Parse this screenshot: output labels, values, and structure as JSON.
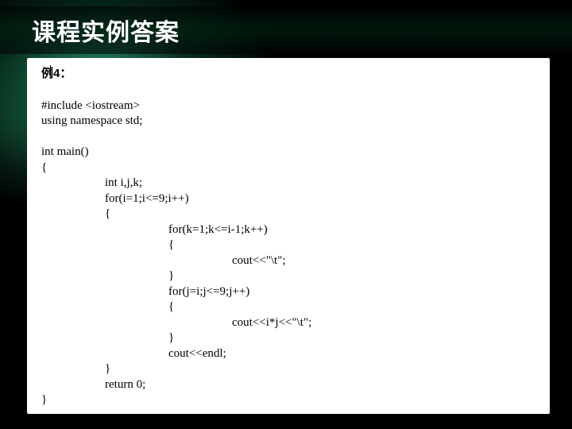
{
  "title": "课程实例答案",
  "example_label": "例4：",
  "code": {
    "l01": "#include <iostream>",
    "l02": "using namespace std;",
    "l03": "",
    "l04": "int main()",
    "l05": "{",
    "l06": "int i,j,k;",
    "l07": "for(i=1;i<=9;i++)",
    "l08": "{",
    "l09": "for(k=1;k<=i-1;k++)",
    "l10": "{",
    "l11": "cout<<\"\\t\";",
    "l12": "}",
    "l13": "for(j=i;j<=9;j++)",
    "l14": "{",
    "l15": "cout<<i*j<<\"\\t\";",
    "l16": "}",
    "l17": "cout<<endl;",
    "l18": "}",
    "l19": "return 0;",
    "l20": "}"
  }
}
